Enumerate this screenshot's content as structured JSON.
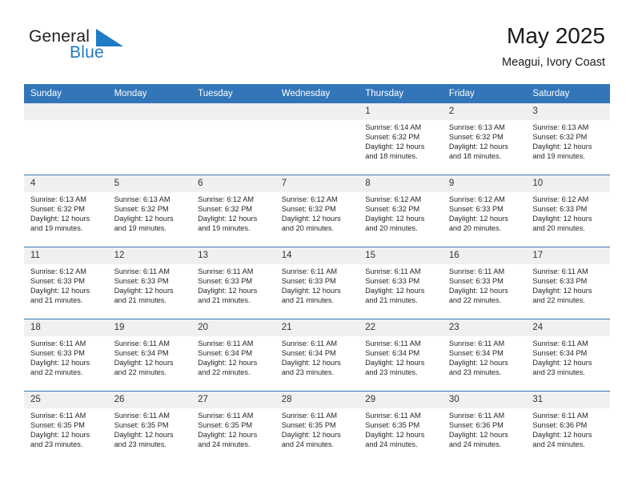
{
  "brand": {
    "name_part1": "General",
    "name_part2": "Blue",
    "logo_icon": "triangle-flag-icon",
    "color_primary": "#1f7bc4",
    "color_text": "#231f20"
  },
  "header": {
    "title": "May 2025",
    "subtitle": "Meagui, Ivory Coast"
  },
  "calendar": {
    "header_bg": "#3275b9",
    "daynum_bg": "#f0f0f0",
    "weekdays": [
      "Sunday",
      "Monday",
      "Tuesday",
      "Wednesday",
      "Thursday",
      "Friday",
      "Saturday"
    ],
    "weeks": [
      [
        {
          "day": "",
          "empty": true,
          "sunrise": "",
          "sunset": "",
          "daylight1": "",
          "daylight2": ""
        },
        {
          "day": "",
          "empty": true,
          "sunrise": "",
          "sunset": "",
          "daylight1": "",
          "daylight2": ""
        },
        {
          "day": "",
          "empty": true,
          "sunrise": "",
          "sunset": "",
          "daylight1": "",
          "daylight2": ""
        },
        {
          "day": "",
          "empty": true,
          "sunrise": "",
          "sunset": "",
          "daylight1": "",
          "daylight2": ""
        },
        {
          "day": "1",
          "empty": false,
          "sunrise": "Sunrise: 6:14 AM",
          "sunset": "Sunset: 6:32 PM",
          "daylight1": "Daylight: 12 hours",
          "daylight2": "and 18 minutes."
        },
        {
          "day": "2",
          "empty": false,
          "sunrise": "Sunrise: 6:13 AM",
          "sunset": "Sunset: 6:32 PM",
          "daylight1": "Daylight: 12 hours",
          "daylight2": "and 18 minutes."
        },
        {
          "day": "3",
          "empty": false,
          "sunrise": "Sunrise: 6:13 AM",
          "sunset": "Sunset: 6:32 PM",
          "daylight1": "Daylight: 12 hours",
          "daylight2": "and 19 minutes."
        }
      ],
      [
        {
          "day": "4",
          "empty": false,
          "sunrise": "Sunrise: 6:13 AM",
          "sunset": "Sunset: 6:32 PM",
          "daylight1": "Daylight: 12 hours",
          "daylight2": "and 19 minutes."
        },
        {
          "day": "5",
          "empty": false,
          "sunrise": "Sunrise: 6:13 AM",
          "sunset": "Sunset: 6:32 PM",
          "daylight1": "Daylight: 12 hours",
          "daylight2": "and 19 minutes."
        },
        {
          "day": "6",
          "empty": false,
          "sunrise": "Sunrise: 6:12 AM",
          "sunset": "Sunset: 6:32 PM",
          "daylight1": "Daylight: 12 hours",
          "daylight2": "and 19 minutes."
        },
        {
          "day": "7",
          "empty": false,
          "sunrise": "Sunrise: 6:12 AM",
          "sunset": "Sunset: 6:32 PM",
          "daylight1": "Daylight: 12 hours",
          "daylight2": "and 20 minutes."
        },
        {
          "day": "8",
          "empty": false,
          "sunrise": "Sunrise: 6:12 AM",
          "sunset": "Sunset: 6:32 PM",
          "daylight1": "Daylight: 12 hours",
          "daylight2": "and 20 minutes."
        },
        {
          "day": "9",
          "empty": false,
          "sunrise": "Sunrise: 6:12 AM",
          "sunset": "Sunset: 6:33 PM",
          "daylight1": "Daylight: 12 hours",
          "daylight2": "and 20 minutes."
        },
        {
          "day": "10",
          "empty": false,
          "sunrise": "Sunrise: 6:12 AM",
          "sunset": "Sunset: 6:33 PM",
          "daylight1": "Daylight: 12 hours",
          "daylight2": "and 20 minutes."
        }
      ],
      [
        {
          "day": "11",
          "empty": false,
          "sunrise": "Sunrise: 6:12 AM",
          "sunset": "Sunset: 6:33 PM",
          "daylight1": "Daylight: 12 hours",
          "daylight2": "and 21 minutes."
        },
        {
          "day": "12",
          "empty": false,
          "sunrise": "Sunrise: 6:11 AM",
          "sunset": "Sunset: 6:33 PM",
          "daylight1": "Daylight: 12 hours",
          "daylight2": "and 21 minutes."
        },
        {
          "day": "13",
          "empty": false,
          "sunrise": "Sunrise: 6:11 AM",
          "sunset": "Sunset: 6:33 PM",
          "daylight1": "Daylight: 12 hours",
          "daylight2": "and 21 minutes."
        },
        {
          "day": "14",
          "empty": false,
          "sunrise": "Sunrise: 6:11 AM",
          "sunset": "Sunset: 6:33 PM",
          "daylight1": "Daylight: 12 hours",
          "daylight2": "and 21 minutes."
        },
        {
          "day": "15",
          "empty": false,
          "sunrise": "Sunrise: 6:11 AM",
          "sunset": "Sunset: 6:33 PM",
          "daylight1": "Daylight: 12 hours",
          "daylight2": "and 21 minutes."
        },
        {
          "day": "16",
          "empty": false,
          "sunrise": "Sunrise: 6:11 AM",
          "sunset": "Sunset: 6:33 PM",
          "daylight1": "Daylight: 12 hours",
          "daylight2": "and 22 minutes."
        },
        {
          "day": "17",
          "empty": false,
          "sunrise": "Sunrise: 6:11 AM",
          "sunset": "Sunset: 6:33 PM",
          "daylight1": "Daylight: 12 hours",
          "daylight2": "and 22 minutes."
        }
      ],
      [
        {
          "day": "18",
          "empty": false,
          "sunrise": "Sunrise: 6:11 AM",
          "sunset": "Sunset: 6:33 PM",
          "daylight1": "Daylight: 12 hours",
          "daylight2": "and 22 minutes."
        },
        {
          "day": "19",
          "empty": false,
          "sunrise": "Sunrise: 6:11 AM",
          "sunset": "Sunset: 6:34 PM",
          "daylight1": "Daylight: 12 hours",
          "daylight2": "and 22 minutes."
        },
        {
          "day": "20",
          "empty": false,
          "sunrise": "Sunrise: 6:11 AM",
          "sunset": "Sunset: 6:34 PM",
          "daylight1": "Daylight: 12 hours",
          "daylight2": "and 22 minutes."
        },
        {
          "day": "21",
          "empty": false,
          "sunrise": "Sunrise: 6:11 AM",
          "sunset": "Sunset: 6:34 PM",
          "daylight1": "Daylight: 12 hours",
          "daylight2": "and 23 minutes."
        },
        {
          "day": "22",
          "empty": false,
          "sunrise": "Sunrise: 6:11 AM",
          "sunset": "Sunset: 6:34 PM",
          "daylight1": "Daylight: 12 hours",
          "daylight2": "and 23 minutes."
        },
        {
          "day": "23",
          "empty": false,
          "sunrise": "Sunrise: 6:11 AM",
          "sunset": "Sunset: 6:34 PM",
          "daylight1": "Daylight: 12 hours",
          "daylight2": "and 23 minutes."
        },
        {
          "day": "24",
          "empty": false,
          "sunrise": "Sunrise: 6:11 AM",
          "sunset": "Sunset: 6:34 PM",
          "daylight1": "Daylight: 12 hours",
          "daylight2": "and 23 minutes."
        }
      ],
      [
        {
          "day": "25",
          "empty": false,
          "sunrise": "Sunrise: 6:11 AM",
          "sunset": "Sunset: 6:35 PM",
          "daylight1": "Daylight: 12 hours",
          "daylight2": "and 23 minutes."
        },
        {
          "day": "26",
          "empty": false,
          "sunrise": "Sunrise: 6:11 AM",
          "sunset": "Sunset: 6:35 PM",
          "daylight1": "Daylight: 12 hours",
          "daylight2": "and 23 minutes."
        },
        {
          "day": "27",
          "empty": false,
          "sunrise": "Sunrise: 6:11 AM",
          "sunset": "Sunset: 6:35 PM",
          "daylight1": "Daylight: 12 hours",
          "daylight2": "and 24 minutes."
        },
        {
          "day": "28",
          "empty": false,
          "sunrise": "Sunrise: 6:11 AM",
          "sunset": "Sunset: 6:35 PM",
          "daylight1": "Daylight: 12 hours",
          "daylight2": "and 24 minutes."
        },
        {
          "day": "29",
          "empty": false,
          "sunrise": "Sunrise: 6:11 AM",
          "sunset": "Sunset: 6:35 PM",
          "daylight1": "Daylight: 12 hours",
          "daylight2": "and 24 minutes."
        },
        {
          "day": "30",
          "empty": false,
          "sunrise": "Sunrise: 6:11 AM",
          "sunset": "Sunset: 6:36 PM",
          "daylight1": "Daylight: 12 hours",
          "daylight2": "and 24 minutes."
        },
        {
          "day": "31",
          "empty": false,
          "sunrise": "Sunrise: 6:11 AM",
          "sunset": "Sunset: 6:36 PM",
          "daylight1": "Daylight: 12 hours",
          "daylight2": "and 24 minutes."
        }
      ]
    ]
  }
}
